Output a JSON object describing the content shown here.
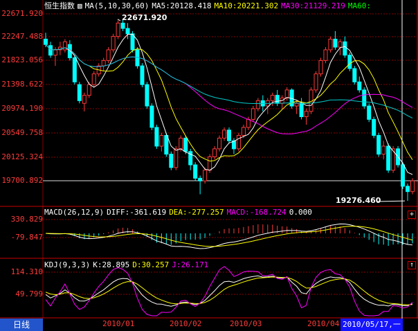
{
  "period_button": "日线",
  "price_header": {
    "index_name": "恒生指数",
    "ma_label": "MA(5,10,30,60)",
    "ma5": "MA5:20128.418",
    "ma10": "MA10:20221.302",
    "ma30": "MA30:21129.219",
    "ma60": "MA60:"
  },
  "macd_header": {
    "label": "MACD(26,12,9)",
    "diff": "DIFF:-361.619",
    "dea": "DEA:-277.257",
    "macd": "MACD:-168.724",
    "zero": "0.000"
  },
  "kdj_header": {
    "label": "KDJ(9,3,3)",
    "k": "K:28.895",
    "d": "D:30.257",
    "j": "J:26.171"
  },
  "price_axis_labels": [
    "22671.920",
    "22247.488",
    "21823.056",
    "21398.622",
    "20974.190",
    "20549.758",
    "20125.324",
    "19700.892"
  ],
  "macd_axis_labels": [
    "330.829",
    "-79.847"
  ],
  "kdj_axis_labels": [
    "114.310",
    "49.799"
  ],
  "annotations": {
    "high": "22671.920",
    "low": "19276.460"
  },
  "x_axis_labels": [
    "2010/01",
    "2010/02",
    "2010/03",
    "2010/04"
  ],
  "cursor_date": "2010/05/17,一",
  "colors": {
    "up": "#ff3b3b",
    "down": "#00ffff",
    "ma5": "#ffffff",
    "ma10": "#ffff00",
    "ma30": "#ff00ff",
    "ma60": "#00ff00",
    "axis_text": "#ff3b3b",
    "grid": "#880000"
  },
  "chart_data": {
    "type": "candlestick",
    "title": "恒生指数",
    "ylim": [
      19200,
      22850
    ],
    "extremes": {
      "high": 22671.92,
      "low": 19276.46
    },
    "ohlc": [
      [
        22300,
        22420,
        22150,
        22200
      ],
      [
        22180,
        22250,
        21950,
        22000
      ],
      [
        22000,
        22150,
        21800,
        22100
      ],
      [
        22100,
        22250,
        22000,
        22150
      ],
      [
        22100,
        22300,
        22050,
        22250
      ],
      [
        22200,
        22280,
        21900,
        21950
      ],
      [
        21950,
        21980,
        21450,
        21500
      ],
      [
        21450,
        21500,
        21100,
        21150
      ],
      [
        21100,
        21300,
        20950,
        21250
      ],
      [
        21250,
        21500,
        21200,
        21450
      ],
      [
        21450,
        21700,
        21400,
        21650
      ],
      [
        21650,
        21850,
        21600,
        21800
      ],
      [
        21800,
        21950,
        21700,
        21900
      ],
      [
        21900,
        22150,
        21850,
        22100
      ],
      [
        22100,
        22400,
        22050,
        22350
      ],
      [
        22350,
        22650,
        22300,
        22600
      ],
      [
        22600,
        22672,
        22450,
        22500
      ],
      [
        22500,
        22600,
        22300,
        22400
      ],
      [
        22400,
        22450,
        22050,
        22100
      ],
      [
        22100,
        22150,
        21750,
        21800
      ],
      [
        21800,
        21850,
        21400,
        21450
      ],
      [
        21450,
        21500,
        21000,
        21050
      ],
      [
        21050,
        21100,
        20600,
        20650
      ],
      [
        20650,
        20700,
        20250,
        20300
      ],
      [
        20300,
        20550,
        20200,
        20500
      ],
      [
        20500,
        20550,
        20100,
        20150
      ],
      [
        20150,
        20200,
        19850,
        19900
      ],
      [
        19900,
        20300,
        19850,
        20250
      ],
      [
        20250,
        20500,
        20200,
        20450
      ],
      [
        20450,
        20500,
        20150,
        20200
      ],
      [
        20200,
        20250,
        19850,
        19950
      ],
      [
        19950,
        20000,
        19650,
        19700
      ],
      [
        19700,
        19750,
        19400,
        19650
      ],
      [
        19650,
        19900,
        19600,
        19850
      ],
      [
        19850,
        20150,
        19800,
        20100
      ],
      [
        20100,
        20300,
        20050,
        20250
      ],
      [
        20250,
        20500,
        20200,
        20450
      ],
      [
        20450,
        20650,
        20400,
        20600
      ],
      [
        20600,
        20650,
        20350,
        20400
      ],
      [
        20400,
        20450,
        20150,
        20250
      ],
      [
        20250,
        20550,
        20200,
        20500
      ],
      [
        20500,
        20700,
        20450,
        20650
      ],
      [
        20650,
        20850,
        20600,
        20800
      ],
      [
        20800,
        21050,
        20750,
        21000
      ],
      [
        21000,
        21200,
        20950,
        21150
      ],
      [
        21150,
        21250,
        20950,
        21050
      ],
      [
        21050,
        21200,
        20900,
        21150
      ],
      [
        21150,
        21300,
        21050,
        21250
      ],
      [
        21250,
        21350,
        21050,
        21100
      ],
      [
        21100,
        21250,
        21000,
        21200
      ],
      [
        21200,
        21400,
        21150,
        21350
      ],
      [
        21350,
        21380,
        21000,
        21050
      ],
      [
        21050,
        21150,
        20900,
        21100
      ],
      [
        21100,
        21200,
        20800,
        20850
      ],
      [
        20850,
        21000,
        20700,
        20950
      ],
      [
        20950,
        21400,
        20900,
        21350
      ],
      [
        21350,
        21700,
        21300,
        21650
      ],
      [
        21650,
        21950,
        21600,
        21900
      ],
      [
        21900,
        22150,
        21850,
        22100
      ],
      [
        22100,
        22350,
        22050,
        22300
      ],
      [
        22300,
        22450,
        22100,
        22150
      ],
      [
        22150,
        22300,
        22000,
        22250
      ],
      [
        22250,
        22350,
        21950,
        22000
      ],
      [
        22000,
        22050,
        21700,
        21750
      ],
      [
        21750,
        21800,
        21450,
        21500
      ],
      [
        21500,
        21600,
        21300,
        21350
      ],
      [
        21350,
        21400,
        21000,
        21050
      ],
      [
        21050,
        21100,
        20750,
        20800
      ],
      [
        20800,
        20850,
        20450,
        20500
      ],
      [
        20500,
        20550,
        20100,
        20150
      ],
      [
        20150,
        20400,
        20050,
        20300
      ],
      [
        20300,
        20350,
        19800,
        19850
      ],
      [
        19850,
        20300,
        19800,
        20250
      ],
      [
        20250,
        20300,
        19900,
        19950
      ],
      [
        19950,
        20000,
        19500,
        19550
      ],
      [
        19550,
        19600,
        19276,
        19450
      ],
      [
        19450,
        19700,
        19400,
        19650
      ]
    ],
    "ma5_last": 20128.418,
    "ma10_last": 20221.302,
    "ma30_last": 21129.219
  }
}
